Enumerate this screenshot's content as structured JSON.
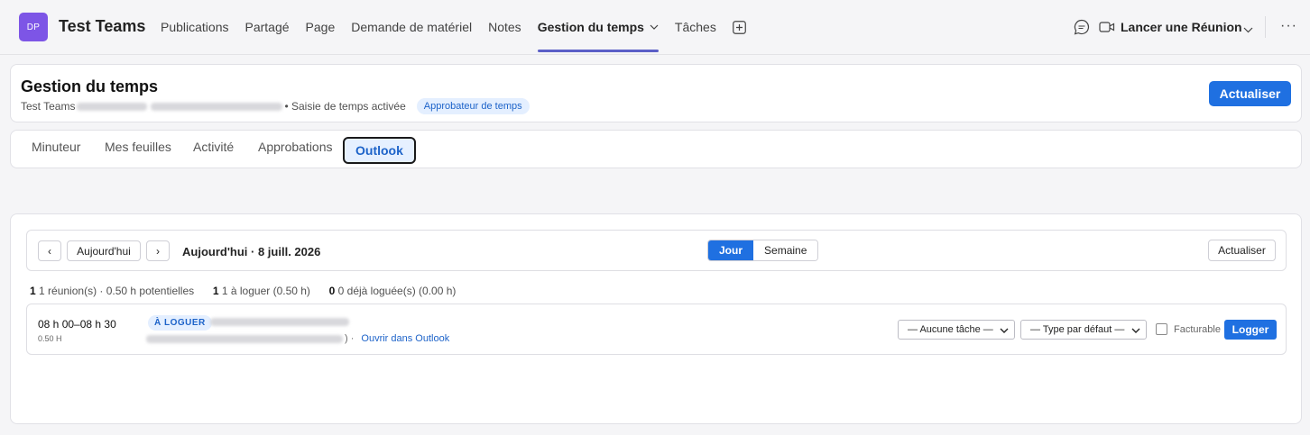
{
  "header": {
    "avatar_initials": "DP",
    "team_name": "Test Teams",
    "nav": [
      {
        "label": "Publications"
      },
      {
        "label": "Partagé"
      },
      {
        "label": "Page"
      },
      {
        "label": "Demande de matériel"
      },
      {
        "label": "Notes"
      },
      {
        "label": "Gestion du temps"
      },
      {
        "label": "Tâches"
      }
    ],
    "meet_label": "Lancer une Réunion",
    "accent": "#5b5fc7"
  },
  "page": {
    "title": "Gestion du temps",
    "team_prefix": "Test Teams",
    "status_text": "• Saisie de temps activée",
    "approver_badge": "Approbateur de temps",
    "refresh_label": "Actualiser"
  },
  "tabs": [
    {
      "label": "Minuteur"
    },
    {
      "label": "Mes feuilles"
    },
    {
      "label": "Activité"
    },
    {
      "label": "Approbations"
    },
    {
      "label": "Outlook"
    }
  ],
  "outlook": {
    "prev_label": "‹",
    "today_label": "Aujourd'hui",
    "next_label": "›",
    "date_label": "Aujourd'hui · 8 juill. 2026",
    "view_day": "Jour",
    "view_week": "Semaine",
    "refresh_label": "Actualiser",
    "summary": {
      "meetings_count": "1",
      "meetings_text": "1 réunion(s) · 0.50 h potentielles",
      "to_log_count": "1",
      "to_log_text": "1 à loguer (0.50 h)",
      "logged_count": "0",
      "logged_text": "0 déjà loguée(s) (0.00 h)"
    },
    "meeting": {
      "time": "08 h 00–08 h 30",
      "duration": "0.50 H",
      "badge": "À LOGUER",
      "sub_suffix": ") ·",
      "open_link": "Ouvrir dans Outlook",
      "task_select": "— Aucune tâche —",
      "type_select": "— Type par défaut —",
      "billable_label": "Facturable",
      "log_button": "Logger"
    }
  },
  "colors": {
    "primary": "#1f70e1",
    "badge_bg": "#e4efff",
    "badge_text": "#1d63c9",
    "avatar": "#7d55e6"
  }
}
